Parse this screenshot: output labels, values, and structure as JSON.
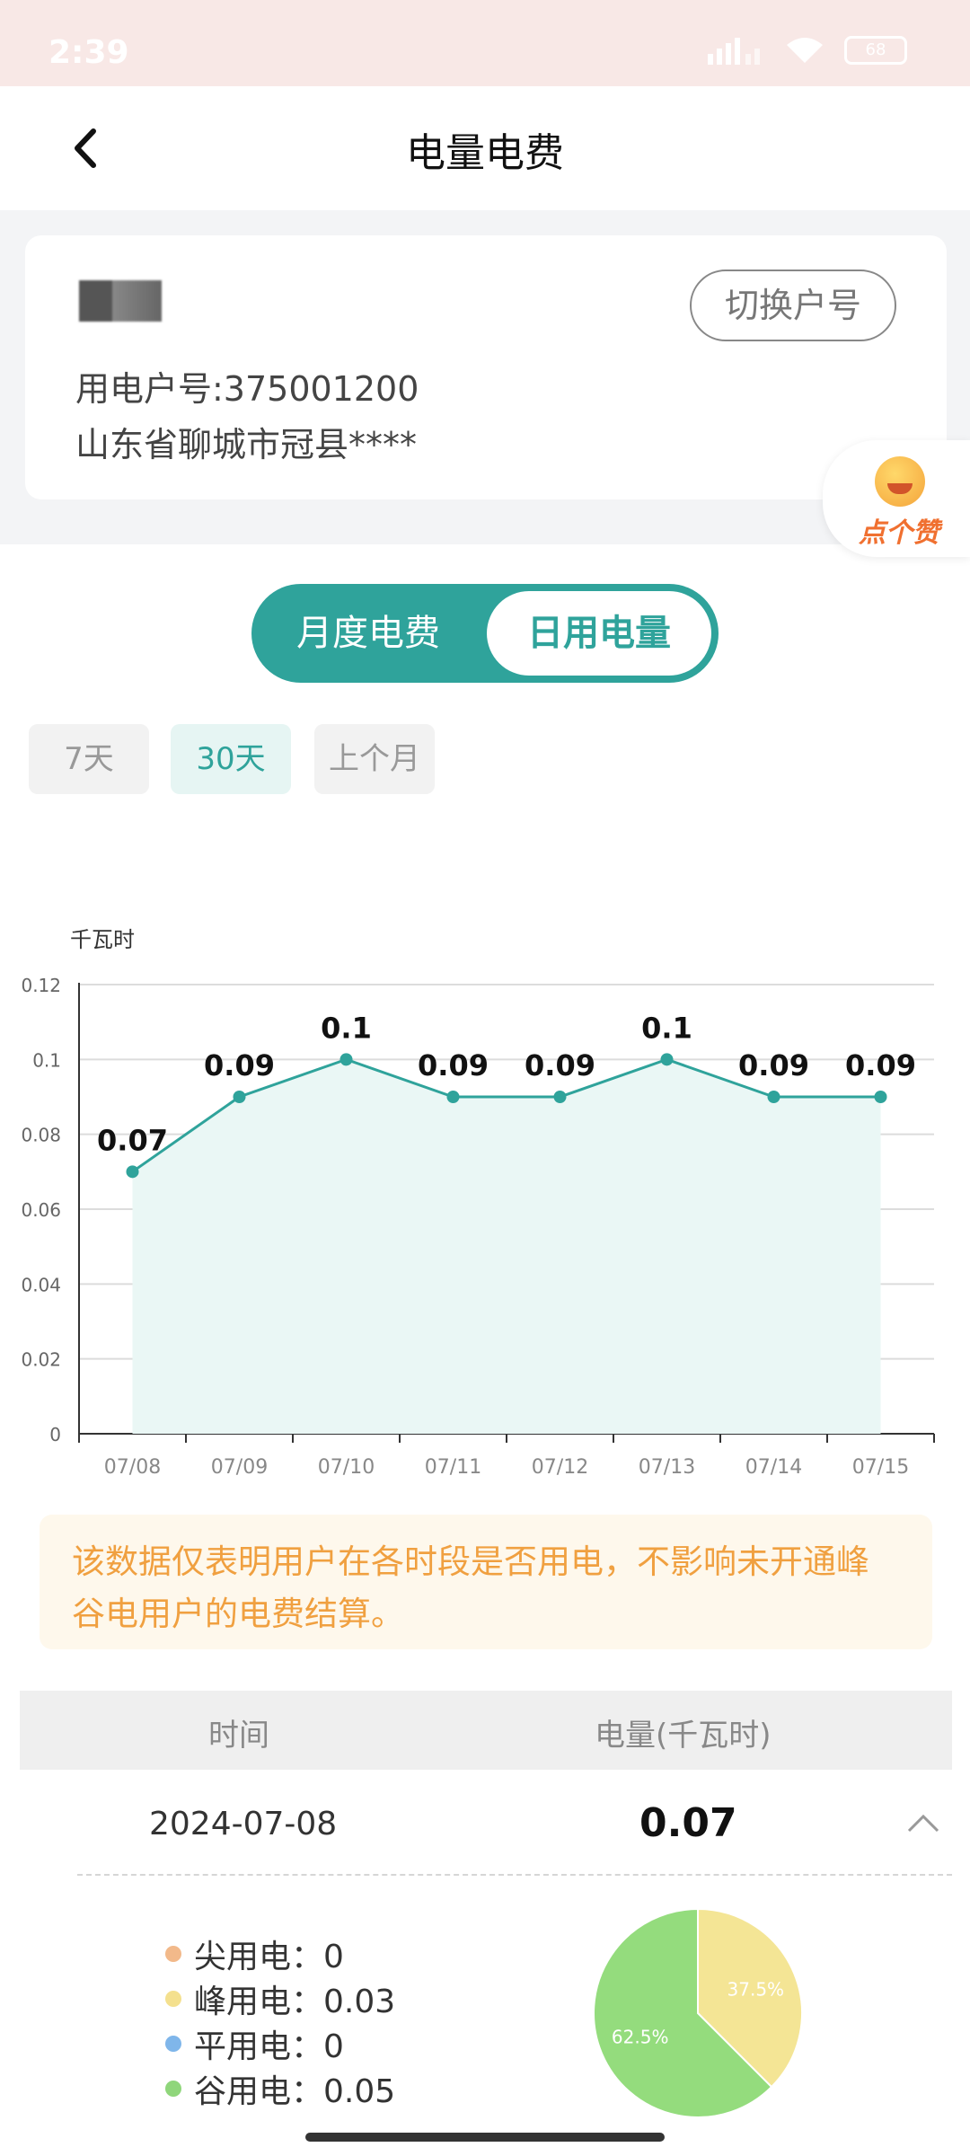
{
  "status": {
    "time": "2:39",
    "battery": "68"
  },
  "header": {
    "title": "电量电费"
  },
  "account": {
    "account_no": "用电户号:375001200",
    "address": "山东省聊城市冠县****",
    "switch_label": "切换户号"
  },
  "like_badge": {
    "label": "点个赞"
  },
  "mode_toggle": {
    "monthly": "月度电费",
    "daily": "日用电量",
    "selected": "日用电量"
  },
  "range_tabs": [
    {
      "label": "7天"
    },
    {
      "label": "30天",
      "active": true
    },
    {
      "label": "上个月"
    }
  ],
  "chart_data": {
    "type": "area",
    "ylabel": "千瓦时",
    "categories": [
      "07/08",
      "07/09",
      "07/10",
      "07/11",
      "07/12",
      "07/13",
      "07/14",
      "07/15"
    ],
    "values": [
      0.07,
      0.09,
      0.1,
      0.09,
      0.09,
      0.1,
      0.09,
      0.09
    ],
    "data_labels": [
      "0.07",
      "0.09",
      "0.1",
      "0.09",
      "0.09",
      "0.1",
      "0.09",
      "0.09"
    ],
    "yticks": [
      "0",
      "0.02",
      "0.04",
      "0.06",
      "0.08",
      "0.1",
      "0.12"
    ],
    "ylim": [
      0,
      0.12
    ],
    "grid": true,
    "line_color": "#2fa39b",
    "fill_color": "#eaf7f5"
  },
  "notice": "该数据仅表明用户在各时段是否用电，不影响未开通峰谷电用户的电费结算。",
  "table": {
    "headers": [
      "时间",
      "电量(千瓦时)"
    ],
    "row": {
      "date": "2024-07-08",
      "value": "0.07"
    }
  },
  "breakdown": {
    "items": [
      {
        "label": "尖用电：0",
        "color": "#f2b98a"
      },
      {
        "label": "峰用电：0.03",
        "color": "#f4e08e"
      },
      {
        "label": "平用电：0",
        "color": "#7fb6ea"
      },
      {
        "label": "谷用电：0.05",
        "color": "#8fd67b"
      }
    ],
    "pie": [
      {
        "name": "峰用电",
        "percent": 37.5,
        "label": "37.5%",
        "color": "#f4e595"
      },
      {
        "name": "谷用电",
        "percent": 62.5,
        "label": "62.5%",
        "color": "#94dc7d"
      }
    ]
  }
}
